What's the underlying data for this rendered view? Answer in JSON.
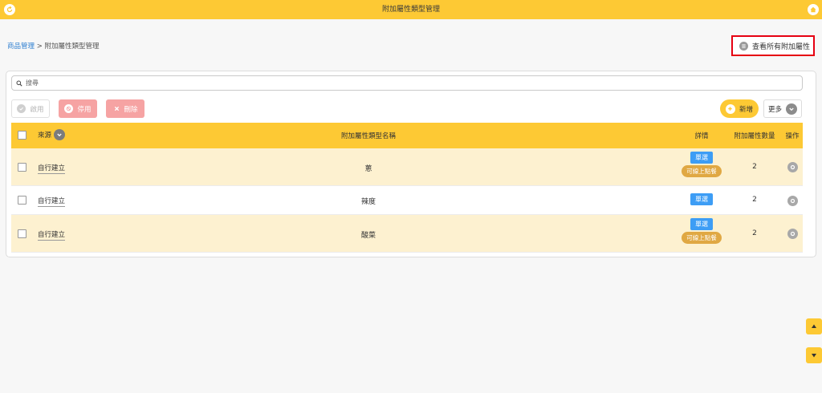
{
  "header": {
    "title": "附加屬性類型管理"
  },
  "breadcrumb": {
    "parent": "商品管理",
    "separator": " > ",
    "current": "附加屬性類型管理"
  },
  "view_all_button": {
    "label": "查看所有附加屬性"
  },
  "search": {
    "placeholder": "搜尋"
  },
  "toolbar": {
    "enable_label": "啟用",
    "disable_label": "停用",
    "delete_label": "刪除",
    "add_label": "新增",
    "more_label": "更多"
  },
  "table": {
    "headers": {
      "source": "來源",
      "name": "附加屬性類型名稱",
      "detail": "詳情",
      "count": "附加屬性數量",
      "operation": "操作"
    },
    "rows": [
      {
        "source": "自行建立",
        "name": "蔥",
        "tag_single": "單選",
        "tag_online": "可線上點餐",
        "count": "2"
      },
      {
        "source": "自行建立",
        "name": "辣度",
        "tag_single": "單選",
        "tag_online": "",
        "count": "2"
      },
      {
        "source": "自行建立",
        "name": "酸菜",
        "tag_single": "單選",
        "tag_online": "可線上點餐",
        "count": "2"
      }
    ]
  },
  "colors": {
    "accent": "#fdc934",
    "row_highlight": "#fdf1d0",
    "danger_soft": "#f6a3a3",
    "tag_blue": "#3d9df5",
    "tag_orange": "#e0a843",
    "highlight_border": "#e60012"
  },
  "icons": {
    "back": "back-circle-icon",
    "home": "home-icon",
    "list": "list-icon",
    "search": "search-icon",
    "enable": "check-circle-icon",
    "disable": "ban-icon",
    "delete": "close-icon",
    "add": "plus-circle-icon",
    "more": "chevron-down-icon",
    "operation": "gear-icon",
    "scroll_up": "triangle-up-icon",
    "scroll_down": "triangle-down-icon"
  }
}
